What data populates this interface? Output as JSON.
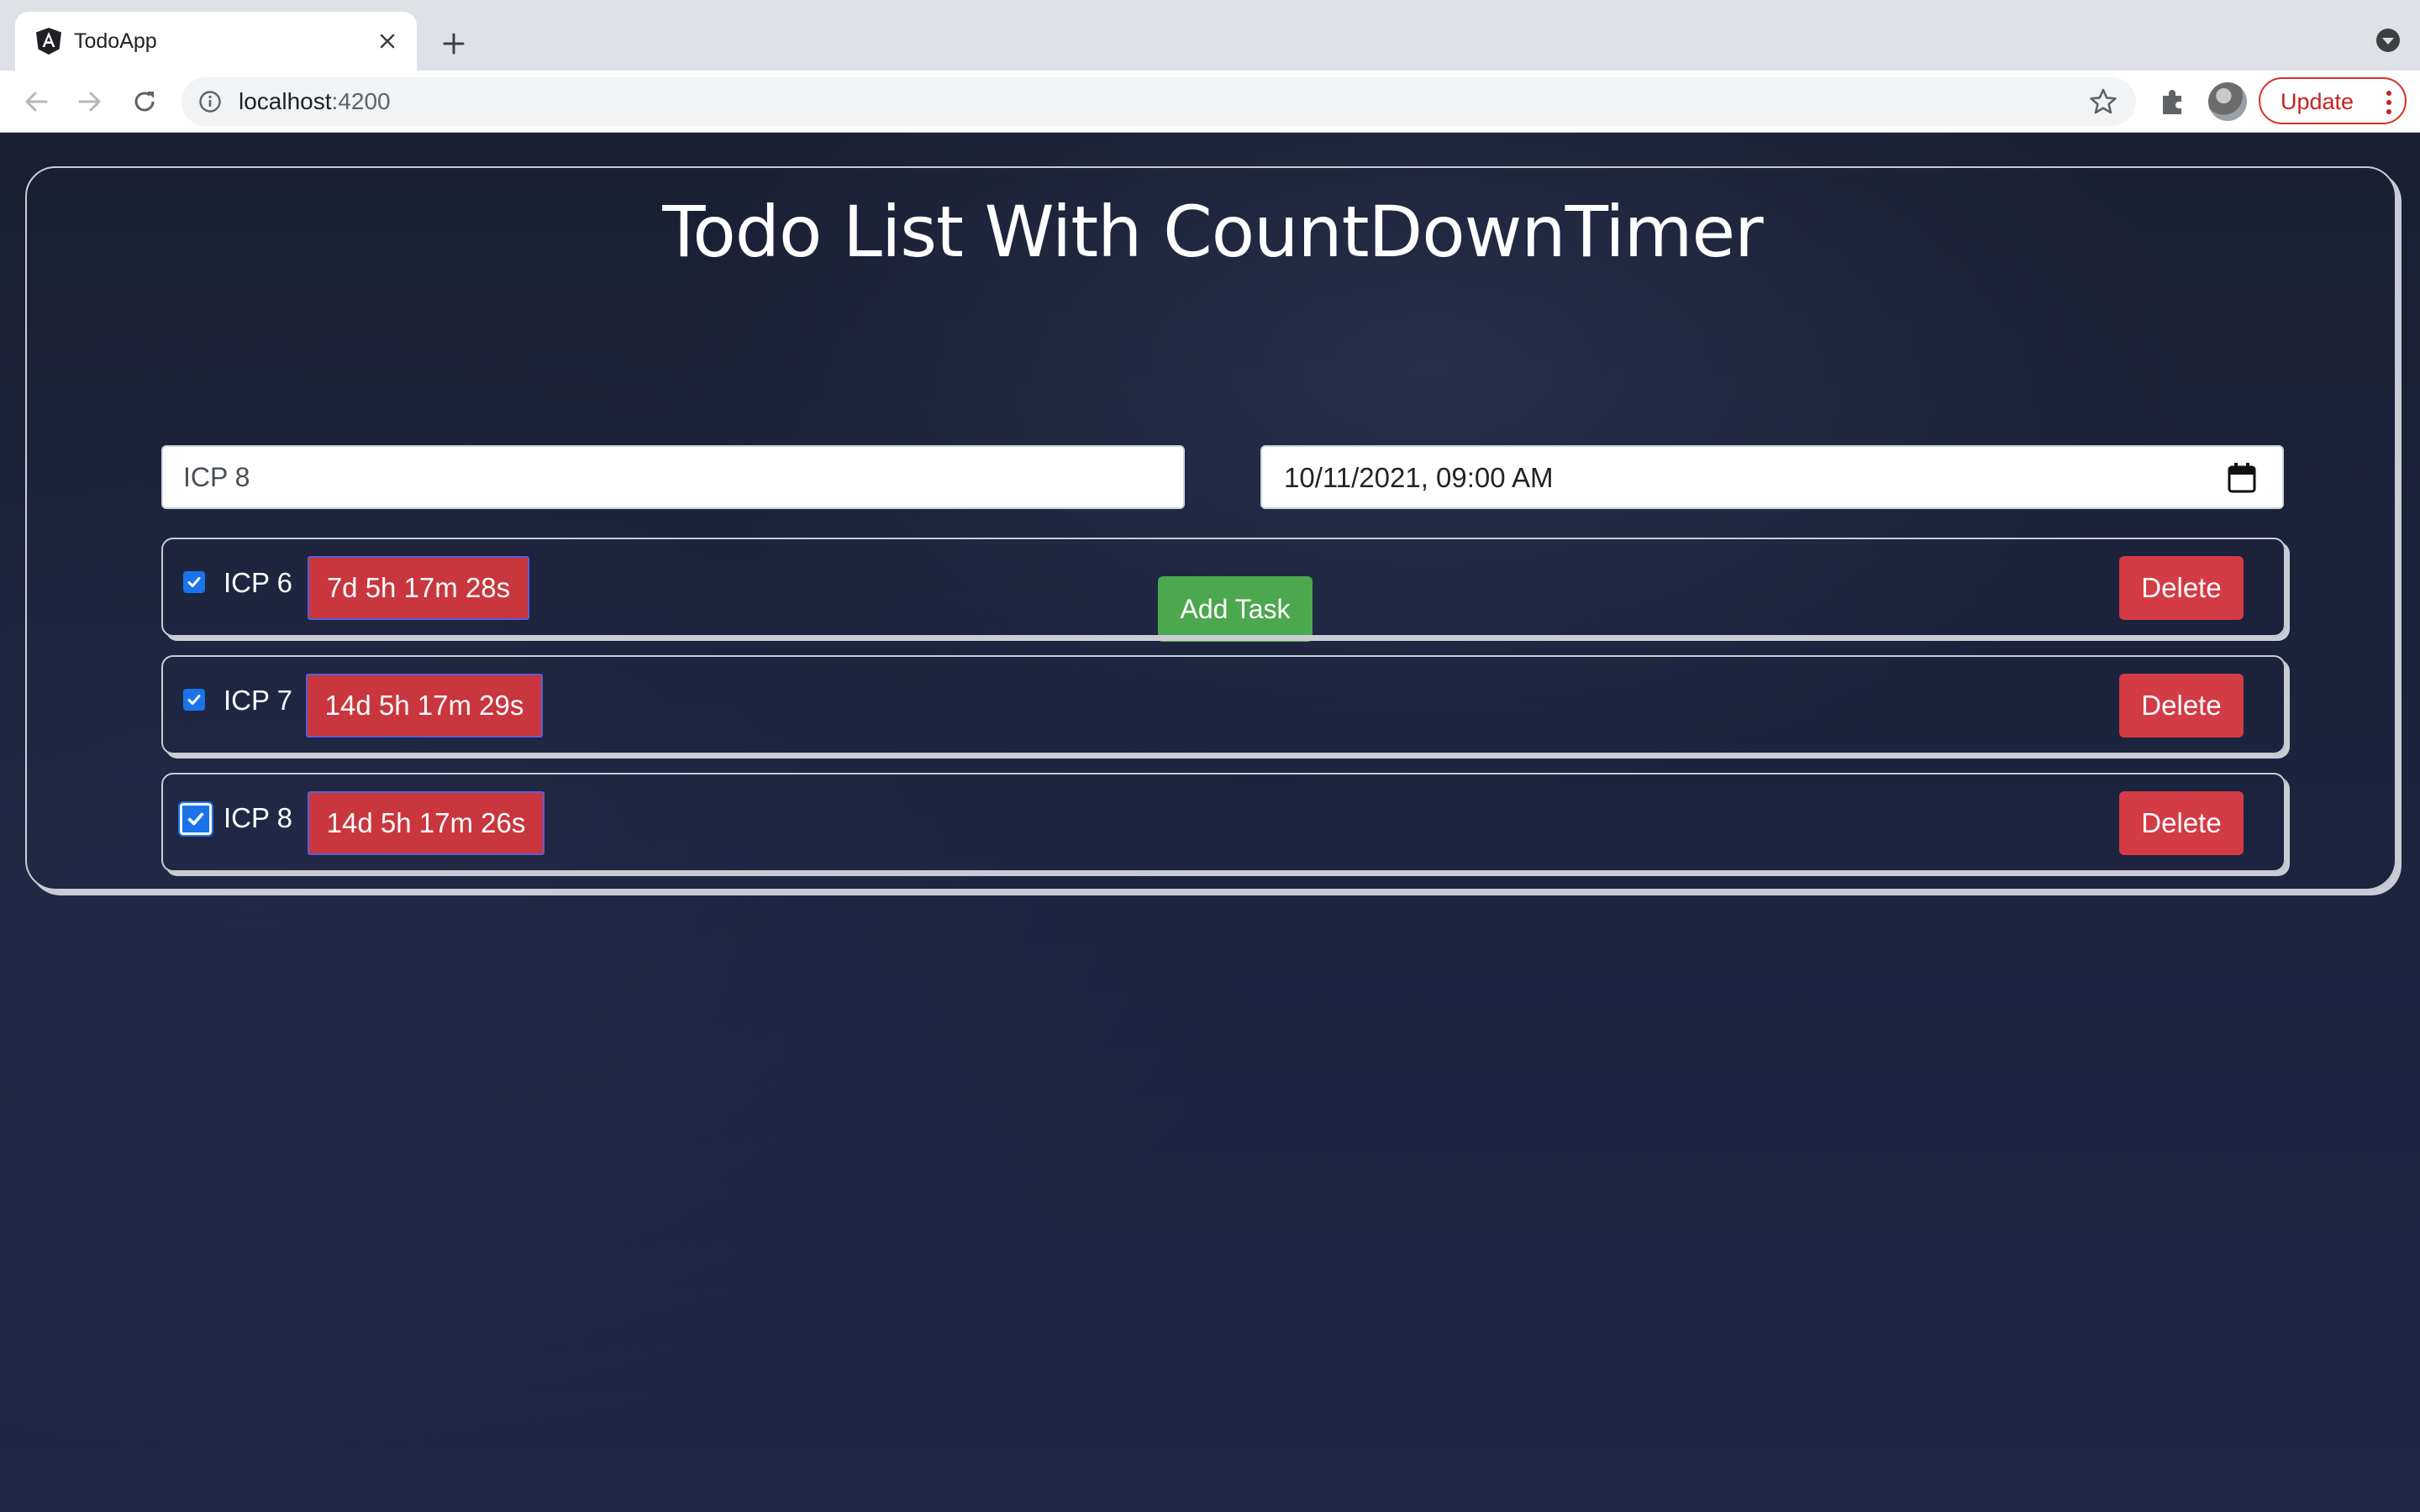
{
  "browser": {
    "tab_title": "TodoApp",
    "url_host": "localhost",
    "url_port": ":4200",
    "update_label": "Update"
  },
  "page": {
    "title": "Todo List With CountDownTimer",
    "task_input_value": "ICP 8",
    "date_input_value": "10/11/2021, 09:00 AM",
    "add_button_label": "Add Task",
    "delete_label": "Delete"
  },
  "tasks": [
    {
      "name": "ICP 6",
      "countdown": "7d 5h 17m 28s",
      "checked": true
    },
    {
      "name": "ICP 7",
      "countdown": "14d 5h 17m 29s",
      "checked": true
    },
    {
      "name": "ICP 8",
      "countdown": "14d 5h 17m 26s",
      "checked": true
    }
  ],
  "colors": {
    "add_button": "#4ca84f",
    "timer_badge": "#c9363d",
    "delete_button": "#d33b45",
    "checkbox": "#1a73e8",
    "background": "#1e2540"
  }
}
